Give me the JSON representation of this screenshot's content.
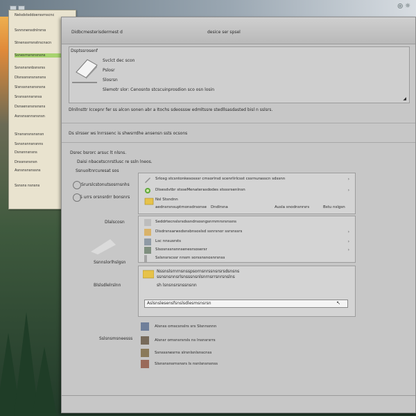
{
  "window": {
    "title_left": "Didbcmesterisdermest d",
    "title_center": "desice ser spsel"
  },
  "header_panel": {
    "label": "Dsptssrosenf",
    "line1": "Svclct dec scon",
    "line2": "Pslosr",
    "line3": "Slosrsn",
    "line4": "Slemotr slor:  Cenosnto stcscuinprosdion sco osn losin"
  },
  "description": "Dlnllnsttr Iccepnr fer ss alcon sonen abr a Itochs sdeosssw edmltssre stedllsasdasted bisl n sslsrs.",
  "section_label": "Ds slrsser ws lnrrssenc is shwsrrdhe ansensn ssts ocsons",
  "options": {
    "heading": "Dsrec bsrorc arsuc lt nlsns.",
    "line1": "Daisi nbacetscnrstlusc re ssln lneos.",
    "line2": "Ssnuoltnrcuresat sos",
    "line3": "Srurslcstonutsosrnsnhs",
    "line4": "S urrs orsnsrdrr bonsnrs"
  },
  "card1": {
    "row1": "Srlosg stcsntonkesosssr cmsorlrsd scenrlirlcsst cssrnurasscn sdssnn",
    "row2": "Dlsesdvtbr stsseMenaterasdodes stsssrsenlnsn",
    "row3": "Nsl Stsndnn",
    "row4_a": "aednsrsnsuptmonsdrsonse",
    "row4_b": "Dndlrsna",
    "row4_c": "Ausla snodnsnrsrs",
    "row4_d": "Bstu nslgsn"
  },
  "mid_labels": {
    "a": "Dlalscosn",
    "b": "Ssnnslorlhslgsn",
    "c": "Blslsdlelrslnn"
  },
  "card2": {
    "row1": "Seddrtecnslsrsdssndrsosngsnrnmrsrsrssns",
    "row2": "Disdrsnsarwsdsnsbnsoslsd ssnrsnor ssrsnssrs",
    "row3": "Lsc nnsusrsts",
    "row4": "Slsosnssnsnnsenesrsosersr",
    "row5": "Sslsnsrscssr nnsrn sorssnsnosnrsnss"
  },
  "card3": {
    "row1": "Nssnslsrnrnsnsspsornsnrssnsrsrsdsnsns",
    "row2": "ssnsnsnnsrlsnsssnsnlsnrnsrrsnrsnslns",
    "row3": "sh lsnsnsrsnssnsnn",
    "input_value": "Aslsnslesensfsnslsdlesmsnsrsn",
    "input_icon": "cursor-icon"
  },
  "bottom": {
    "label": "Sslsnsmsneesss",
    "item1": "Alsnss omscsnslrs srs Slsnnsnnn",
    "item2": "Alsnsr omsnsrsrsls ns lnsnsrsrrs",
    "item3": "Ssnsssnesrns slrsnlsnlsnscnss",
    "item4": "Slsnsnsnsrnsnsrs ls nsnlsnsnsnss"
  },
  "left_panel": {
    "items": [
      "Nelsdstsddoerssrnscnc",
      "Ssnrsnensdnlrsrss",
      "Stnenssrrsnstrscnscn",
      "Ssnesrnsrsnsnsns",
      "Ssnsnsrsnbsnsrss",
      "Dlsnssnsnsnsnsns",
      "Slsnssnsnsnsnsns",
      "Snsnssnnsrsnss",
      "Dsnsensnsnsnsns",
      "Asnsnssnnsnsnsn",
      "Slnsnsnsnsnsnsn",
      "Ssnsnsnnsnsnns",
      "Dsnsnnsnsns",
      "Dnssnsnsnsn",
      "Asnsnsnsnssns",
      "Ssnsns nsnsns"
    ]
  },
  "colors": {
    "window_bg": "#c7c7c7",
    "highlight": "#a7d36f",
    "folder": "#e6c24a"
  }
}
